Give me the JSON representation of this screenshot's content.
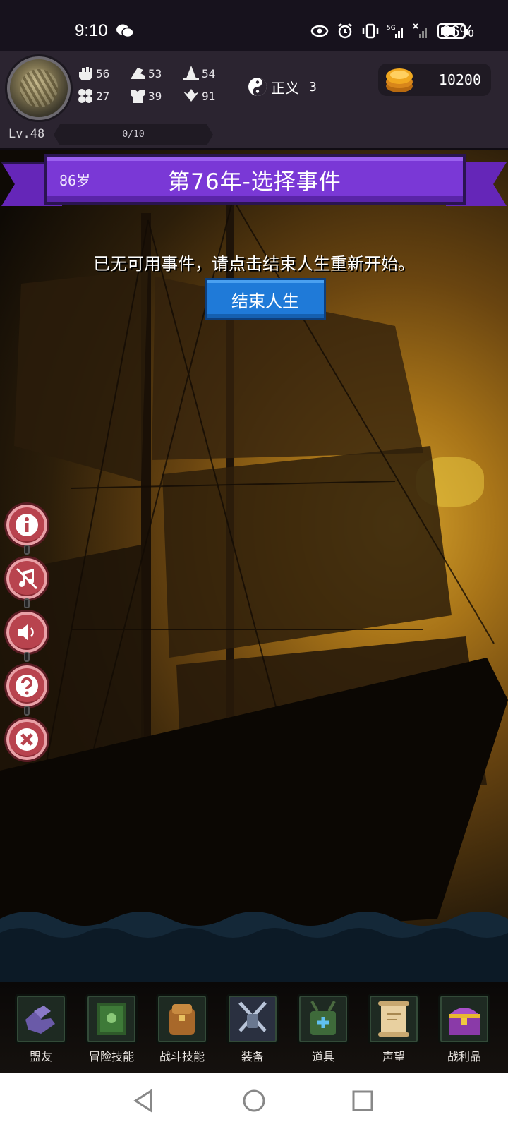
{
  "status_bar": {
    "time": "9:10",
    "battery_pct_label": "66%",
    "battery_level": 0.66,
    "icons": [
      "wechat-icon",
      "eye-icon",
      "alarm-icon",
      "vibrate-icon",
      "5g-signal-icon",
      "signal-icon",
      "battery-icon"
    ]
  },
  "header": {
    "stats": [
      {
        "icon": "fist-icon",
        "value": "56"
      },
      {
        "icon": "shoe-icon",
        "value": "53"
      },
      {
        "icon": "wizard-hat-icon",
        "value": "54"
      },
      {
        "icon": "clover-icon",
        "value": "27"
      },
      {
        "icon": "armor-icon",
        "value": "39"
      },
      {
        "icon": "wings-icon",
        "value": "91"
      }
    ],
    "morality_label": "正义",
    "morality_value": "3",
    "coins": "10200",
    "level": "Lv.48",
    "xp_text": "0/10",
    "xp_fraction": 0
  },
  "banner": {
    "age_num": "86",
    "age_unit": "岁",
    "title": "第76年-选择事件"
  },
  "event": {
    "message": "已无可用事件，请点击结束人生重新开始。",
    "end_button": "结束人生"
  },
  "side_buttons": [
    "info-icon",
    "music-off-icon",
    "sound-icon",
    "help-icon",
    "close-icon"
  ],
  "dock": [
    {
      "label": "盟友",
      "icon": "gloves-icon"
    },
    {
      "label": "冒险技能",
      "icon": "book-icon"
    },
    {
      "label": "战斗技能",
      "icon": "backpack-icon"
    },
    {
      "label": "装备",
      "icon": "crossed-swords-icon"
    },
    {
      "label": "道具",
      "icon": "satchel-icon"
    },
    {
      "label": "声望",
      "icon": "scroll-icon"
    },
    {
      "label": "战利品",
      "icon": "treasure-chest-icon"
    }
  ],
  "colors": {
    "banner": "#7a38d6",
    "button": "#1f7ad8",
    "side_button": "#b8434e",
    "gold": "#e8a020"
  }
}
